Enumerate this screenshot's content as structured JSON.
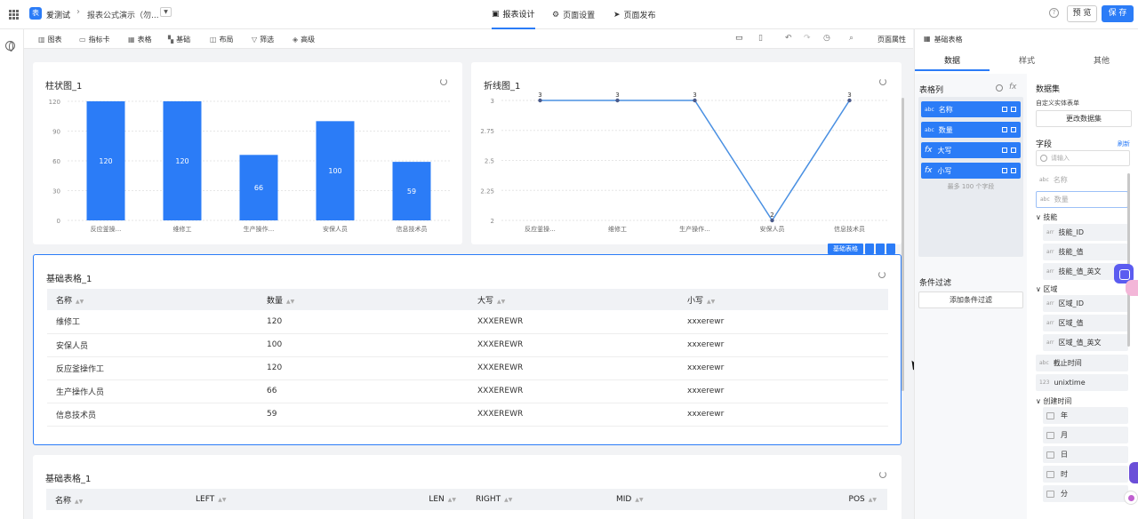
{
  "app": {
    "name": "爱测试",
    "breadcrumb": "报表公式演示（勿...",
    "logo": "表"
  },
  "topnav": [
    {
      "label": "报表设计",
      "icon": "report-icon",
      "active": true
    },
    {
      "label": "页面设置",
      "icon": "gear-icon",
      "active": false
    },
    {
      "label": "页面发布",
      "icon": "send-icon",
      "active": false
    }
  ],
  "actions": {
    "preview": "预 览",
    "save": "保 存",
    "help": "?"
  },
  "toolbar": {
    "items": [
      {
        "label": "图表",
        "icon": "bar-chart-icon"
      },
      {
        "label": "指标卡",
        "icon": "metric-card-icon"
      },
      {
        "label": "表格",
        "icon": "table-icon"
      },
      {
        "label": "基础",
        "icon": "basic-icon"
      },
      {
        "label": "布局",
        "icon": "layout-icon"
      },
      {
        "label": "筛选",
        "icon": "filter-icon"
      },
      {
        "label": "高级",
        "icon": "advanced-icon"
      }
    ],
    "page_props": "页面属性"
  },
  "bar_card": {
    "title": "柱状图_1"
  },
  "line_card": {
    "title": "折线图_1"
  },
  "chart_data": [
    {
      "type": "bar",
      "title": "柱状图_1",
      "categories": [
        "反应釜操...",
        "维修工",
        "生产操作...",
        "安保人员",
        "信息技术员"
      ],
      "values": [
        120,
        120,
        66,
        100,
        59
      ],
      "yticks": [
        "0",
        "30",
        "60",
        "90",
        "120"
      ],
      "ylim": [
        0,
        120
      ],
      "color": "#2b7cf7"
    },
    {
      "type": "line",
      "title": "折线图_1",
      "categories": [
        "反应釜操...",
        "维修工",
        "生产操作...",
        "安保人员",
        "信息技术员"
      ],
      "values": [
        3,
        3,
        3,
        2,
        3
      ],
      "yticks": [
        "2",
        "2.25",
        "2.5",
        "2.75",
        "3"
      ],
      "ylim": [
        2,
        3
      ],
      "color": "#4a90e2"
    }
  ],
  "selection": {
    "tag": "基础表格"
  },
  "table1": {
    "title": "基础表格_1",
    "headers": [
      "名称",
      "数量",
      "大写",
      "小写"
    ],
    "rows": [
      [
        "维修工",
        "120",
        "XXXEREWR",
        "xxxerewr"
      ],
      [
        "安保人员",
        "100",
        "XXXEREWR",
        "xxxerewr"
      ],
      [
        "反应釜操作工",
        "120",
        "XXXEREWR",
        "xxxerewr"
      ],
      [
        "生产操作人员",
        "66",
        "XXXEREWR",
        "xxxerewr"
      ],
      [
        "信息技术员",
        "59",
        "XXXEREWR",
        "xxxerewr"
      ]
    ]
  },
  "table2": {
    "title": "基础表格_1",
    "headers": [
      "名称",
      "LEFT",
      "LEN",
      "RIGHT",
      "MID",
      "POS"
    ]
  },
  "right_panel": {
    "header": "基础表格",
    "tabs": [
      "数据",
      "样式",
      "其他"
    ],
    "columns_title": "表格列",
    "fx": "fx",
    "columns": [
      {
        "type": "abc",
        "name": "名称",
        "formula": false
      },
      {
        "type": "abc",
        "name": "数量",
        "formula": false
      },
      {
        "type": "fx",
        "name": "大写",
        "formula": true
      },
      {
        "type": "fx",
        "name": "小写",
        "formula": true
      }
    ],
    "more_hint": "最多 100 个字段",
    "filter_title": "条件过滤",
    "add_filter": "添加条件过滤",
    "dataset_title": "数据集",
    "dataset_name": "自定义实体表单",
    "change_dataset": "更改数据集",
    "fields_title": "字段",
    "refresh": "刷新",
    "search_placeholder": "请输入",
    "fields": {
      "top": [
        {
          "type": "abc",
          "name": "名称"
        },
        {
          "type": "abc",
          "name": "数量"
        }
      ],
      "skill_group": "技能",
      "skill": [
        {
          "type": "arr",
          "name": "技能_ID"
        },
        {
          "type": "arr",
          "name": "技能_值"
        },
        {
          "type": "arr",
          "name": "技能_值_英文"
        }
      ],
      "region_group": "区域",
      "region": [
        {
          "type": "arr",
          "name": "区域_ID"
        },
        {
          "type": "arr",
          "name": "区域_值"
        },
        {
          "type": "arr",
          "name": "区域_值_英文"
        }
      ],
      "mid": [
        {
          "type": "abc",
          "name": "截止时间"
        },
        {
          "type": "123",
          "name": "unixtime"
        }
      ],
      "created_group": "创建时间",
      "created": [
        "年",
        "月",
        "日",
        "时",
        "分"
      ]
    }
  }
}
